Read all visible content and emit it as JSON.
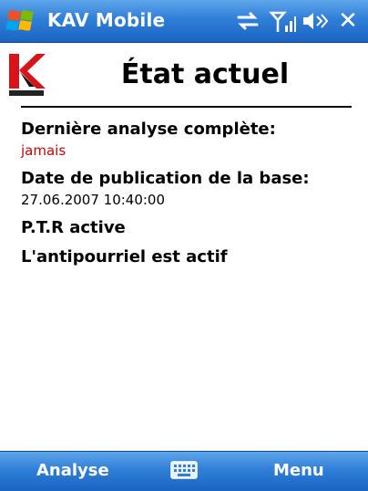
{
  "titlebar": {
    "app_title": "KAV Mobile",
    "close_label": "✕",
    "icons": [
      "windows-start-icon",
      "sync-icon",
      "signal-icon",
      "speaker-icon"
    ]
  },
  "header": {
    "title": "État actuel",
    "logo_icon": "kaspersky-logo"
  },
  "status": {
    "last_scan_label": "Dernière analyse complète:",
    "last_scan_value": "jamais",
    "db_date_label": "Date de publication de la base:",
    "db_date_value": "27.06.2007 10:40:00",
    "ptr_label": "P.T.R active",
    "antispam_label": "L'antipourriel est actif"
  },
  "softkeys": {
    "left": "Analyse",
    "right": "Menu",
    "center_icon": "keyboard-icon"
  },
  "colors": {
    "bar_blue": "#2f7fd8",
    "alert_red": "#d40000"
  }
}
